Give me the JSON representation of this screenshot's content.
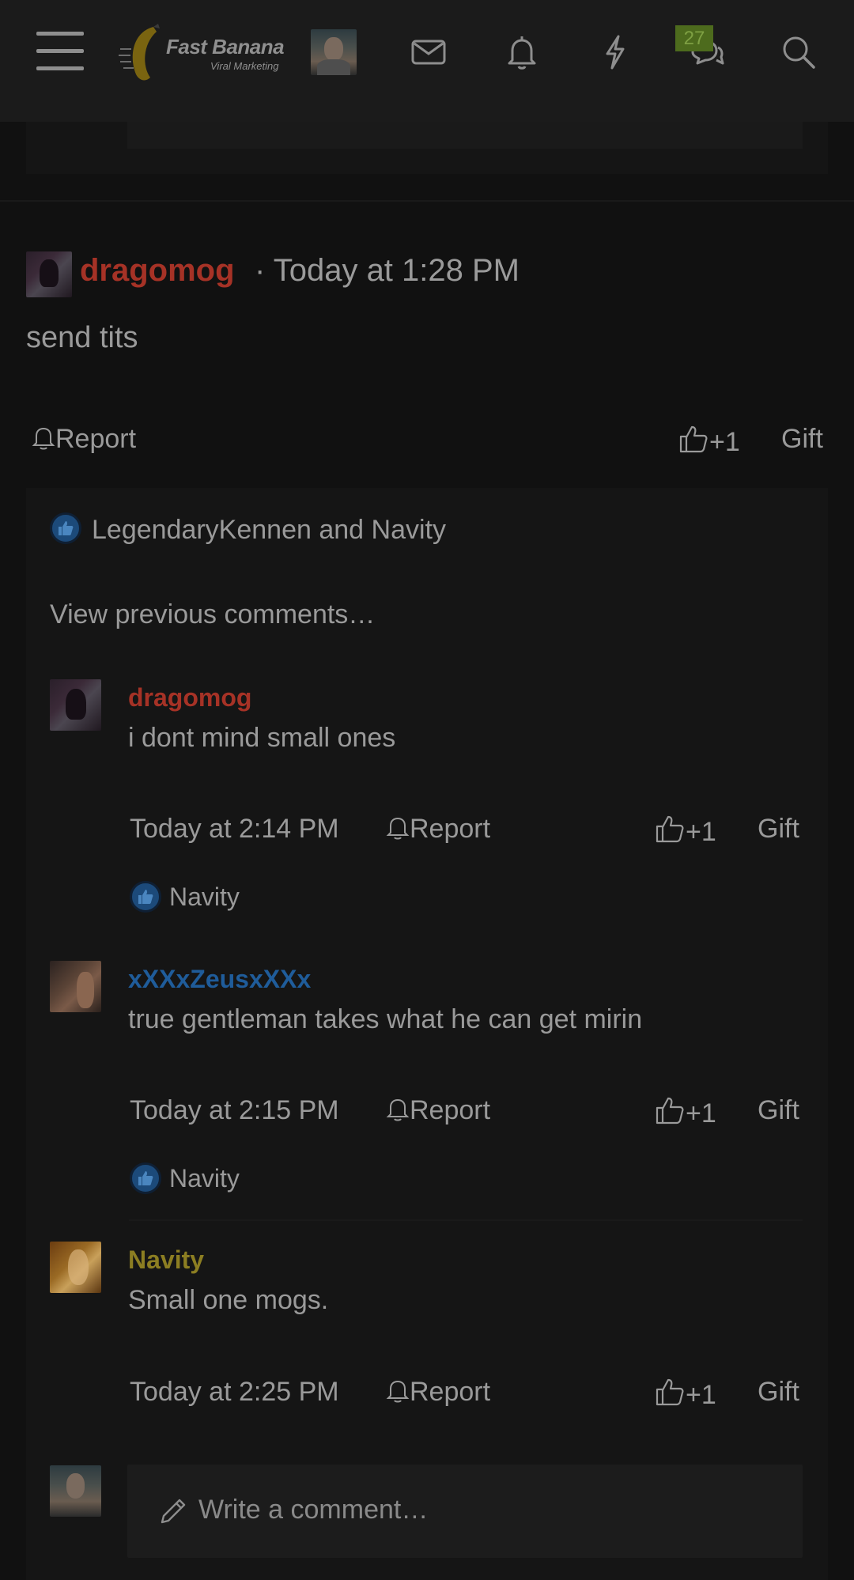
{
  "header": {
    "logo_title": "Fast Banana",
    "logo_subtitle": "Viral Marketing",
    "conversations_badge": "27",
    "icons": [
      "menu-icon",
      "envelope-icon",
      "bell-icon",
      "lightning-icon",
      "chat-icon",
      "search-icon"
    ]
  },
  "post": {
    "username": "dragomog",
    "meta": "· Today at 1:28 PM",
    "body": "send tits",
    "report_label": "Report",
    "like_label": "+1",
    "gift_label": "Gift",
    "likes_text": "LegendaryKennen and Navity",
    "view_previous": "View previous comments…"
  },
  "comments": [
    {
      "username": "dragomog",
      "username_color": "#a63226",
      "text": "i dont mind small ones",
      "time": "Today at 2:14 PM",
      "report_label": "Report",
      "like_label": "+1",
      "gift_label": "Gift",
      "likes_text": "Navity"
    },
    {
      "username": "xXXxZeusxXXx",
      "username_color": "#1f5c9a",
      "text": "true gentleman takes what he can get mirin",
      "time": "Today at 2:15 PM",
      "report_label": "Report",
      "like_label": "+1",
      "gift_label": "Gift",
      "likes_text": "Navity"
    },
    {
      "username": "Navity",
      "username_color": "#8c7e22",
      "text": "Small one mogs.",
      "time": "Today at 2:25 PM",
      "report_label": "Report",
      "like_label": "+1",
      "gift_label": "Gift"
    }
  ],
  "composer": {
    "placeholder": "Write a comment…"
  },
  "colors": {
    "background": "#111111",
    "header": "#1b1b1b",
    "panel": "#151515",
    "badge": "#4d6b1d",
    "like": "#1c4a7a"
  }
}
